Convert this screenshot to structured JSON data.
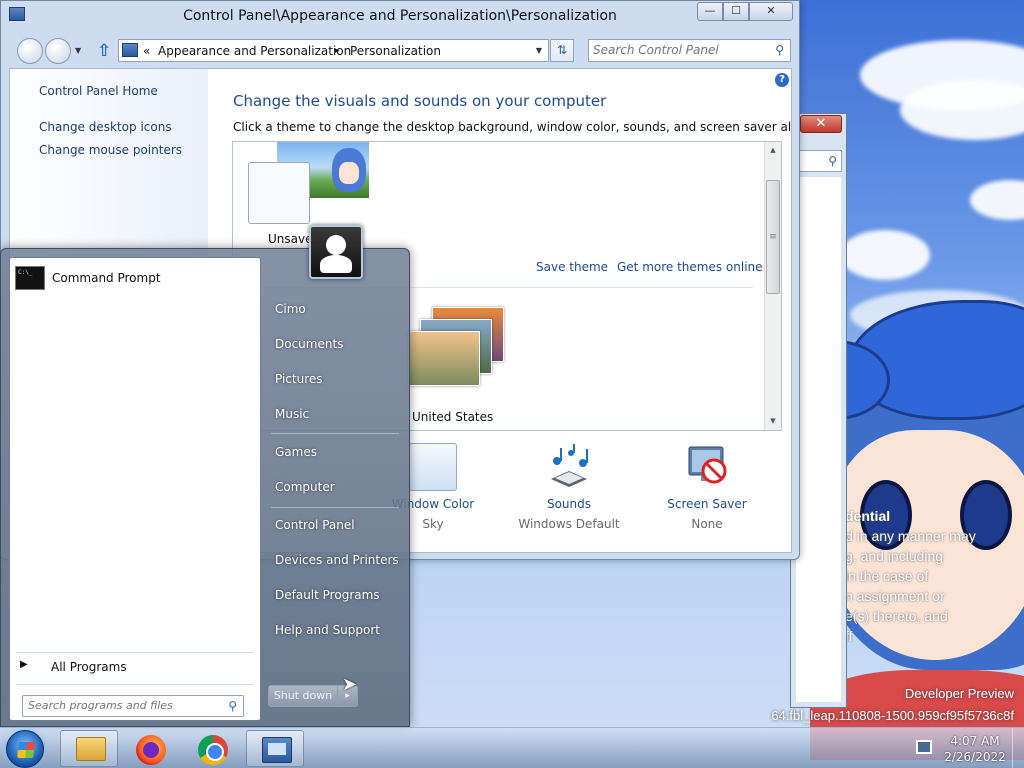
{
  "window": {
    "title": "Control Panel\\Appearance and Personalization\\Personalization",
    "minimize": "—",
    "maximize": "☐",
    "close": "✕"
  },
  "address": {
    "chevron": "«",
    "crumbs": [
      "Appearance and Personalization",
      "Personalization"
    ],
    "separator": "▸",
    "search_placeholder": "Search Control Panel"
  },
  "sidebar": {
    "items": [
      {
        "label": "Control Panel Home"
      },
      {
        "label": "Change desktop icons"
      },
      {
        "label": "Change mouse pointers"
      }
    ]
  },
  "main": {
    "heading": "Change the visuals and sounds on your computer",
    "subheading": "Click a theme to change the desktop background, window color, sounds, and screen saver all at once.",
    "help": "?",
    "themes": {
      "unsaved_label": "Unsaved",
      "save_theme": "Save theme",
      "get_more": "Get more themes online",
      "us_theme_label": "United States"
    },
    "bottom": [
      {
        "label": "Window Color",
        "value": "Sky"
      },
      {
        "label": "Sounds",
        "value": "Windows Default"
      },
      {
        "label": "Screen Saver",
        "value": "None"
      }
    ]
  },
  "bg_window": {
    "close": "✕"
  },
  "desktop": {
    "confidential_title": "dential",
    "confidential_lines": [
      "d in any manner may",
      "g, and including",
      "in the case of",
      "n assignment or",
      "e(s) thereto, and",
      "ff"
    ],
    "watermark_1": "Developer Preview",
    "watermark_2": "64.fbl_leap.110808-1500.959cf95f5736c8f"
  },
  "start_menu": {
    "program": "Command Prompt",
    "all_programs": "All Programs",
    "search_placeholder": "Search programs and files",
    "right_links": [
      "Cimo",
      "Documents",
      "Pictures",
      "Music",
      "Games",
      "Computer",
      "Control Panel",
      "Devices and Printers",
      "Default Programs",
      "Help and Support"
    ],
    "shutdown": "Shut down",
    "shutdown_arrow": "▸"
  },
  "taskbar": {
    "time": "4:07 AM",
    "date": "2/26/2022"
  }
}
